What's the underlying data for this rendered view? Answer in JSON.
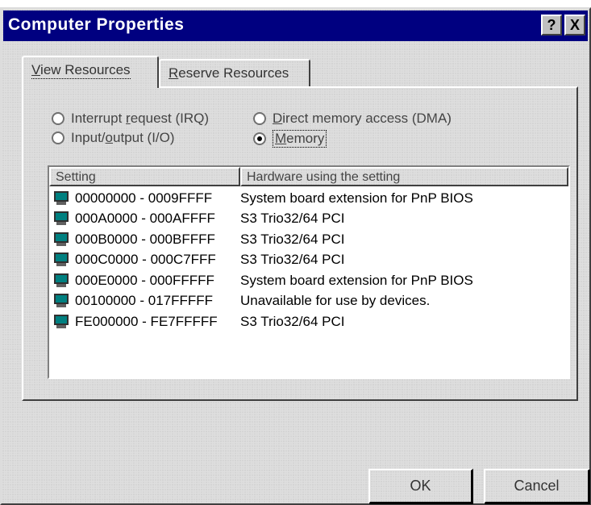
{
  "window": {
    "title": "Computer Properties",
    "help_glyph": "?",
    "close_glyph": "X"
  },
  "tabs": [
    {
      "label_prefix": "",
      "label_accel": "V",
      "label_rest": "iew Resources",
      "selected": true
    },
    {
      "label_prefix": "",
      "label_accel": "R",
      "label_rest": "eserve Resources",
      "selected": false
    }
  ],
  "radios": {
    "irq": {
      "prefix": "Interrupt ",
      "accel": "r",
      "rest": "equest (IRQ)",
      "checked": false
    },
    "io": {
      "prefix": "Input/",
      "accel": "o",
      "rest": "utput (I/O)",
      "checked": false
    },
    "dma": {
      "prefix": "",
      "accel": "D",
      "rest": "irect memory access (DMA)",
      "checked": false
    },
    "memory": {
      "prefix": "",
      "accel": "M",
      "rest": "emory",
      "checked": true
    }
  },
  "list": {
    "columns": [
      "Setting",
      "Hardware using the setting"
    ],
    "rows": [
      {
        "icon": "system-board-icon",
        "setting": "00000000 - 0009FFFF",
        "hardware": "System board extension for PnP BIOS"
      },
      {
        "icon": "display-adapter-icon",
        "setting": "000A0000 - 000AFFFF",
        "hardware": "S3 Trio32/64 PCI"
      },
      {
        "icon": "display-adapter-icon",
        "setting": "000B0000 - 000BFFFF",
        "hardware": "S3 Trio32/64 PCI"
      },
      {
        "icon": "display-adapter-icon",
        "setting": "000C0000 - 000C7FFF",
        "hardware": "S3 Trio32/64 PCI"
      },
      {
        "icon": "system-board-icon",
        "setting": "000E0000 - 000FFFFF",
        "hardware": "System board extension for PnP BIOS"
      },
      {
        "icon": "system-board-icon",
        "setting": "00100000 - 017FFFFF",
        "hardware": "Unavailable for use by devices."
      },
      {
        "icon": "display-adapter-icon",
        "setting": "FE000000 - FE7FFFFF",
        "hardware": "S3 Trio32/64 PCI"
      }
    ]
  },
  "buttons": {
    "ok": "OK",
    "cancel": "Cancel"
  },
  "colors": {
    "titlebar": "#000080",
    "face": "#c0c0c0",
    "monitor_screen": "#008080"
  }
}
